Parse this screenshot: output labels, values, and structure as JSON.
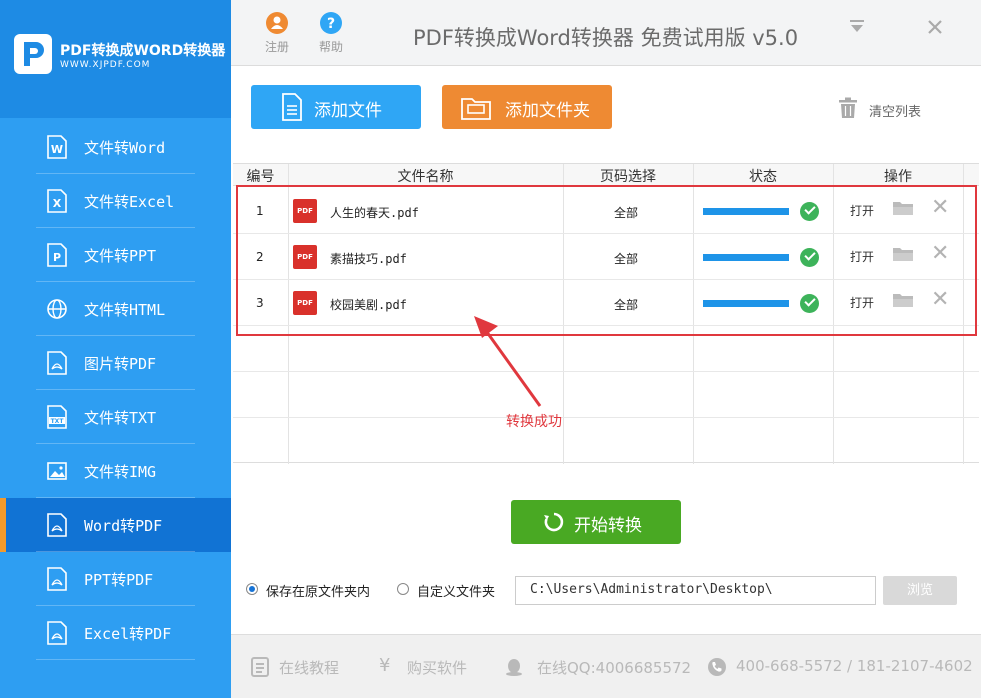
{
  "brand": {
    "title": "PDF转换成WORD转换器",
    "url": "WWW.XJPDF.COM"
  },
  "sidebar": {
    "items": [
      {
        "label": "文件转Word",
        "icon": "word-doc-icon",
        "active": false
      },
      {
        "label": "文件转Excel",
        "icon": "excel-doc-icon",
        "active": false
      },
      {
        "label": "文件转PPT",
        "icon": "ppt-doc-icon",
        "active": false
      },
      {
        "label": "文件转HTML",
        "icon": "globe-icon",
        "active": false
      },
      {
        "label": "图片转PDF",
        "icon": "pdf-doc-icon",
        "active": false
      },
      {
        "label": "文件转TXT",
        "icon": "txt-doc-icon",
        "active": false
      },
      {
        "label": "文件转IMG",
        "icon": "image-icon",
        "active": false
      },
      {
        "label": "Word转PDF",
        "icon": "pdf-doc-icon",
        "active": true
      },
      {
        "label": "PPT转PDF",
        "icon": "pdf-doc-icon",
        "active": false
      },
      {
        "label": "Excel转PDF",
        "icon": "pdf-doc-icon",
        "active": false
      }
    ]
  },
  "titlebar": {
    "register_label": "注册",
    "help_label": "帮助",
    "title": "PDF转换成Word转换器 免费试用版 v5.0",
    "minimize": "▼",
    "close": "✕"
  },
  "toolbar": {
    "add_file": "添加文件",
    "add_folder": "添加文件夹",
    "clear_list": "清空列表"
  },
  "table": {
    "headers": [
      "编号",
      "文件名称",
      "页码选择",
      "状态",
      "操作"
    ],
    "rows": [
      {
        "no": "1",
        "name": "人生的春天.pdf",
        "pages": "全部",
        "progress": 1.0,
        "open": "打开"
      },
      {
        "no": "2",
        "name": "素描技巧.pdf",
        "pages": "全部",
        "progress": 1.0,
        "open": "打开"
      },
      {
        "no": "3",
        "name": "校园美剧.pdf",
        "pages": "全部",
        "progress": 1.0,
        "open": "打开"
      }
    ],
    "pdf_badge": "PDF"
  },
  "annotation": {
    "text": "转换成功"
  },
  "start": {
    "label": "开始转换"
  },
  "save": {
    "option_original": "保存在原文件夹内",
    "option_custom": "自定义文件夹",
    "selected": "original",
    "path": "C:\\Users\\Administrator\\Desktop\\",
    "browse": "浏览"
  },
  "footer": {
    "tutorial": "在线教程",
    "buy": "购买软件",
    "qq": "在线QQ:4006685572",
    "phone": "400-668-5572 / 181-2107-4602"
  },
  "colors": {
    "sidebar": "#2e9ef2",
    "active": "#1173d4",
    "accent_orange": "#ee8a33",
    "blue_button": "#2fa6f5",
    "green_button": "#49a923",
    "highlight_red": "#e0383e"
  }
}
